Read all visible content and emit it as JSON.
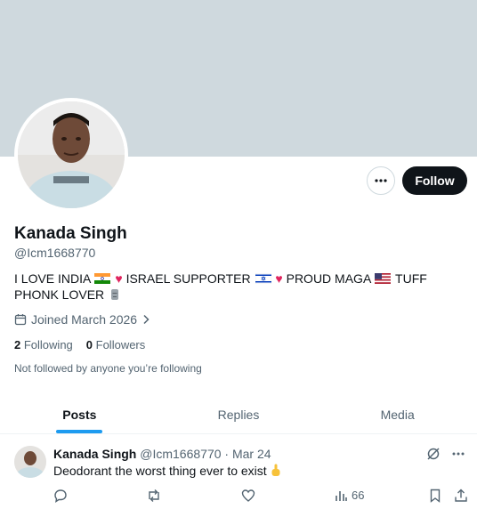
{
  "profile": {
    "name": "Kanada Singh",
    "handle": "@Icm1668770",
    "bio": {
      "part1": "I LOVE INDIA",
      "part2": "ISRAEL SUPPORTER",
      "part3": "PROUD MAGA",
      "part4": "TUFF PHONK LOVER"
    },
    "joined": "Joined March 2026",
    "following_count": "2",
    "following_label": "Following",
    "followers_count": "0",
    "followers_label": "Followers",
    "not_followed_text": "Not followed by anyone you’re following",
    "follow_button": "Follow"
  },
  "tabs": [
    {
      "label": "Posts",
      "active": true
    },
    {
      "label": "Replies",
      "active": false
    },
    {
      "label": "Media",
      "active": false
    }
  ],
  "post": {
    "author": "Kanada Singh",
    "handle": "@Icm1668770",
    "separator": "·",
    "date": "Mar 24",
    "text": "Deodorant the worst thing ever to exist",
    "views": "66"
  },
  "colors": {
    "banner": "#cfd9de",
    "accent": "#1d9bf0",
    "text": "#0f1419",
    "secondary": "#536471",
    "heart": "#e0245e"
  },
  "icons": [
    "more-dots-icon",
    "calendar-icon",
    "chevron-right-icon",
    "grok-icon",
    "reply-icon",
    "repost-icon",
    "like-icon",
    "views-icon",
    "bookmark-icon",
    "share-icon"
  ]
}
